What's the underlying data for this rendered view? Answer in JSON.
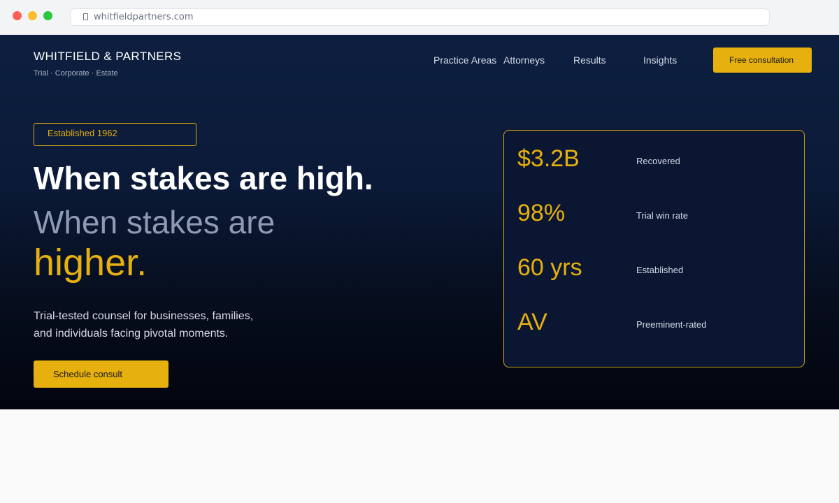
{
  "browser": {
    "url": "whitfieldpartners.com"
  },
  "header": {
    "brand": "WHITFIELD & PARTNERS",
    "tagline": "Trial · Corporate · Estate",
    "nav": [
      "Practice Areas",
      "Attorneys",
      "Results",
      "Insights"
    ],
    "cta_label": "Free consultation"
  },
  "hero": {
    "badge": "Established 1962",
    "line1": "When stakes are high.",
    "line2": "When stakes are",
    "line3": "higher.",
    "lead_line1": "Trial-tested counsel for businesses, families,",
    "lead_line2": "and individuals facing pivotal moments.",
    "cta_label": "Schedule consult"
  },
  "stats": [
    {
      "value": "$3.2B",
      "label": "Recovered"
    },
    {
      "value": "98%",
      "label": "Trial win rate"
    },
    {
      "value": "60 yrs",
      "label": "Established"
    },
    {
      "value": "AV",
      "label": "Preeminent-rated"
    }
  ],
  "colors": {
    "accent": "#e6b00e",
    "navy": "#0d1f40",
    "muted_text": "#8f9bb3"
  }
}
